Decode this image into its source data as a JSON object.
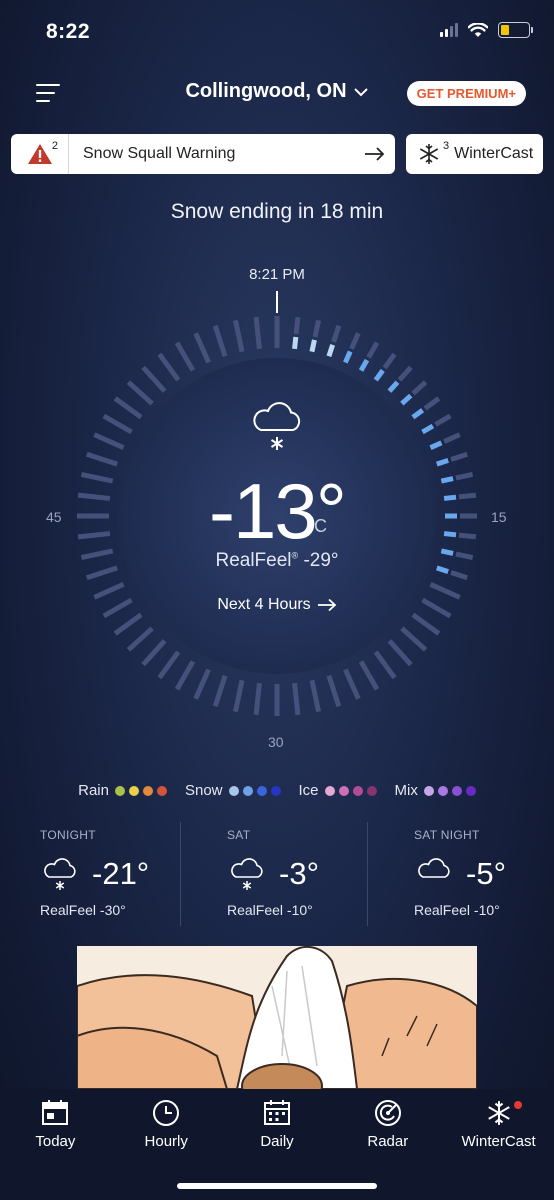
{
  "status": {
    "time": "8:22"
  },
  "header": {
    "location": "Collingwood, ON",
    "premium_label": "GET PREMIUM+"
  },
  "alert": {
    "count": "2",
    "text": "Snow Squall Warning"
  },
  "wintercast_card": {
    "count": "3",
    "label": "WinterCast"
  },
  "headline": "Snow ending in 18 min",
  "dial": {
    "time": "8:21 PM",
    "label_left": "45",
    "label_right": "15",
    "label_bottom": "30",
    "precip_minutes_from_top": 18
  },
  "current": {
    "temp": "-13°",
    "unit": "C",
    "realfeel_label": "RealFeel",
    "realfeel_mark": "®",
    "realfeel_value": "-29°",
    "next_hours": "Next 4 Hours"
  },
  "legend": [
    {
      "label": "Rain",
      "colors": [
        "#a9c34a",
        "#e7d14a",
        "#e28a3a",
        "#d4533a"
      ]
    },
    {
      "label": "Snow",
      "colors": [
        "#a9c6ea",
        "#6f9fe6",
        "#3b63de",
        "#2636c2"
      ]
    },
    {
      "label": "Ice",
      "colors": [
        "#e5a7d3",
        "#d06fb7",
        "#b34c98",
        "#87346f"
      ]
    },
    {
      "label": "Mix",
      "colors": [
        "#c6a8e8",
        "#a978e0",
        "#8a4fd6",
        "#6a2bc4"
      ]
    }
  ],
  "forecast": [
    {
      "label": "TONIGHT",
      "temp": "-21°",
      "realfeel": "RealFeel -30°",
      "icon": "snow-cloud-icon"
    },
    {
      "label": "SAT",
      "temp": "-3°",
      "realfeel": "RealFeel -10°",
      "icon": "snow-cloud-icon"
    },
    {
      "label": "SAT NIGHT",
      "temp": "-5°",
      "realfeel": "RealFeel -10°",
      "icon": "cloud-icon"
    }
  ],
  "tabs": [
    {
      "label": "Today",
      "icon": "calendar-day-icon"
    },
    {
      "label": "Hourly",
      "icon": "clock-icon"
    },
    {
      "label": "Daily",
      "icon": "calendar-icon"
    },
    {
      "label": "Radar",
      "icon": "radar-icon"
    },
    {
      "label": "WinterCast",
      "icon": "snowflake-icon"
    }
  ],
  "colors": {
    "accent_orange": "#e35a2f",
    "precip_light": "#bcd8f5",
    "precip_blue": "#6aa8ee",
    "alert_red": "#c0392b"
  }
}
